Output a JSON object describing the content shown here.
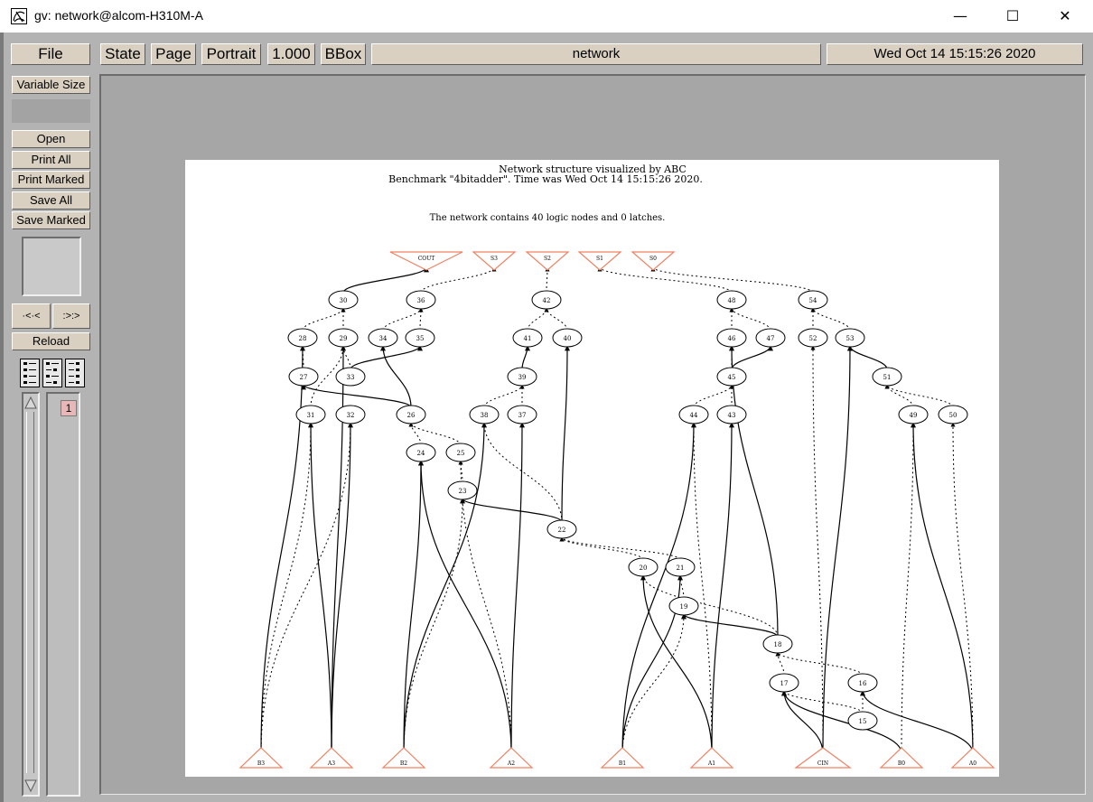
{
  "window": {
    "title": "gv: network@alcom-H310M-A",
    "minimize": "—",
    "maximize": "☐",
    "close": "✕"
  },
  "toolbar": {
    "file": "File",
    "state": "State",
    "page": "Page",
    "orientation": "Portrait",
    "zoom": "1.000",
    "bbox": "BBox",
    "document_name": "network",
    "date": "Wed Oct 14 15:15:26 2020"
  },
  "sidebar": {
    "size_mode": "Variable Size",
    "open": "Open",
    "print_all": "Print All",
    "print_marked": "Print Marked",
    "save_all": "Save All",
    "save_marked": "Save Marked",
    "prev_page": "·<·<",
    "next_page": ":>:>",
    "reload": "Reload",
    "page_number": "1"
  },
  "icons": {
    "app": "gv-app-icon",
    "page_layout": [
      "layout-mode-1-icon",
      "layout-mode-2-icon",
      "layout-mode-3-icon"
    ]
  },
  "colors": {
    "app_background": "#b3b3b3",
    "button_face": "#d9d0c1",
    "output_triangle": "#f08060",
    "page_number_badge": "#e8b8b8"
  },
  "document": {
    "title_line1": "Network structure visualized by ABC",
    "title_line2": "Benchmark \"4bitadder\". Time was Wed Oct 14 15:15:26 2020.",
    "summary": "The network contains 40 logic nodes and 0 latches.",
    "outputs": [
      "COUT",
      "S3",
      "S2",
      "S1",
      "S0"
    ],
    "inputs": [
      "B3",
      "A3",
      "B2",
      "A2",
      "B1",
      "A1",
      "CIN",
      "B0",
      "A0"
    ],
    "node_labels": [
      "30",
      "36",
      "42",
      "48",
      "54",
      "28",
      "29",
      "34",
      "35",
      "41",
      "40",
      "46",
      "47",
      "52",
      "53",
      "27",
      "33",
      "39",
      "45",
      "51",
      "31",
      "32",
      "26",
      "38",
      "37",
      "44",
      "43",
      "49",
      "50",
      "24",
      "25",
      "23",
      "22",
      "20",
      "21",
      "19",
      "18",
      "17",
      "16",
      "15"
    ]
  }
}
